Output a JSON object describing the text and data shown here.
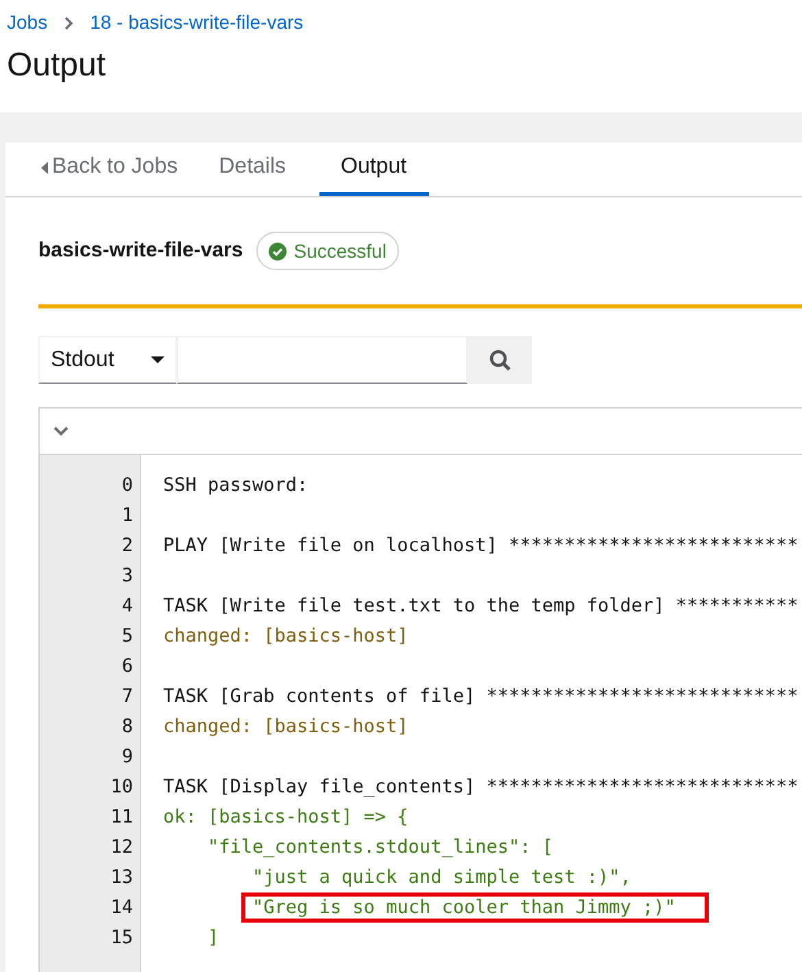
{
  "breadcrumb": [
    {
      "label": "Jobs"
    },
    {
      "label": "18 - basics-write-file-vars"
    }
  ],
  "title": "Output",
  "tabs": [
    {
      "label": "Back to Jobs",
      "kind": "back",
      "selected": false
    },
    {
      "label": "Details",
      "kind": "tab",
      "selected": false
    },
    {
      "label": "Output",
      "kind": "tab",
      "selected": true
    }
  ],
  "job": {
    "name": "basics-write-file-vars",
    "status": "Successful"
  },
  "filter": {
    "value": "Stdout"
  },
  "output": {
    "lines": [
      {
        "number": "0",
        "text": "SSH password:",
        "kind": "plain",
        "highlighted": false
      },
      {
        "number": "1",
        "kind": "plain",
        "highlighted": false
      },
      {
        "number": "2",
        "text": "PLAY [Write file on localhost] **************************",
        "kind": "plain",
        "highlighted": false
      },
      {
        "number": "3",
        "kind": "plain",
        "highlighted": false
      },
      {
        "number": "4",
        "text": "TASK [Write file test.txt to the temp folder] ***********",
        "kind": "plain",
        "highlighted": false
      },
      {
        "number": "5",
        "text": "changed: [basics-host]",
        "kind": "changed",
        "highlighted": false
      },
      {
        "number": "6",
        "kind": "plain",
        "highlighted": false
      },
      {
        "number": "7",
        "text": "TASK [Grab contents of file] ****************************",
        "kind": "plain",
        "highlighted": false
      },
      {
        "number": "8",
        "text": "changed: [basics-host]",
        "kind": "changed",
        "highlighted": false
      },
      {
        "number": "9",
        "kind": "plain",
        "highlighted": false
      },
      {
        "number": "10",
        "text": "TASK [Display file_contents] ****************************",
        "kind": "plain",
        "highlighted": false
      },
      {
        "number": "11",
        "text": "ok: [basics-host] => {",
        "kind": "ok",
        "highlighted": false
      },
      {
        "number": "12",
        "text": "    \"file_contents.stdout_lines\": [",
        "kind": "ok",
        "highlighted": false
      },
      {
        "number": "13",
        "text": "        \"just a quick and simple test :)\",",
        "kind": "ok",
        "highlighted": false
      },
      {
        "number": "14",
        "text": "        \"Greg is so much cooler than Jimmy ;)\"",
        "kind": "ok",
        "highlighted": true
      },
      {
        "number": "15",
        "text": "    ]",
        "kind": "ok",
        "highlighted": false
      }
    ]
  }
}
